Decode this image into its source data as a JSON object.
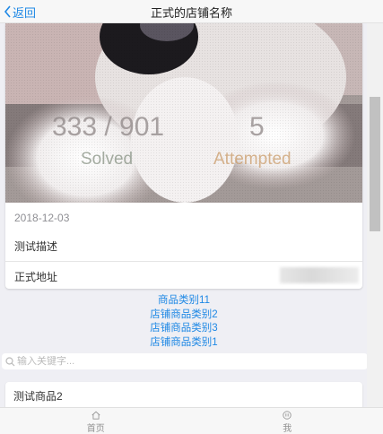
{
  "header": {
    "back_label": "返回",
    "title": "正式的店铺名称"
  },
  "store": {
    "date": "2018-12-03",
    "description": "测试描述",
    "address_label": "正式地址",
    "banner_text": {
      "score": "333 / 901",
      "left_caption": "Solved",
      "right_number": "5",
      "right_caption": "Attempted"
    }
  },
  "categories": [
    "商品类别11",
    "店铺商品类别2",
    "店铺商品类别3",
    "店铺商品类别1"
  ],
  "search": {
    "placeholder": "输入关键字..."
  },
  "products": [
    {
      "name": "测试商品2"
    }
  ],
  "tabbar": {
    "items": [
      {
        "label": "首页",
        "icon": "home-icon"
      },
      {
        "label": "我",
        "icon": "user-icon"
      }
    ]
  },
  "colors": {
    "accent": "#1e88e5",
    "background": "#efeff4"
  }
}
